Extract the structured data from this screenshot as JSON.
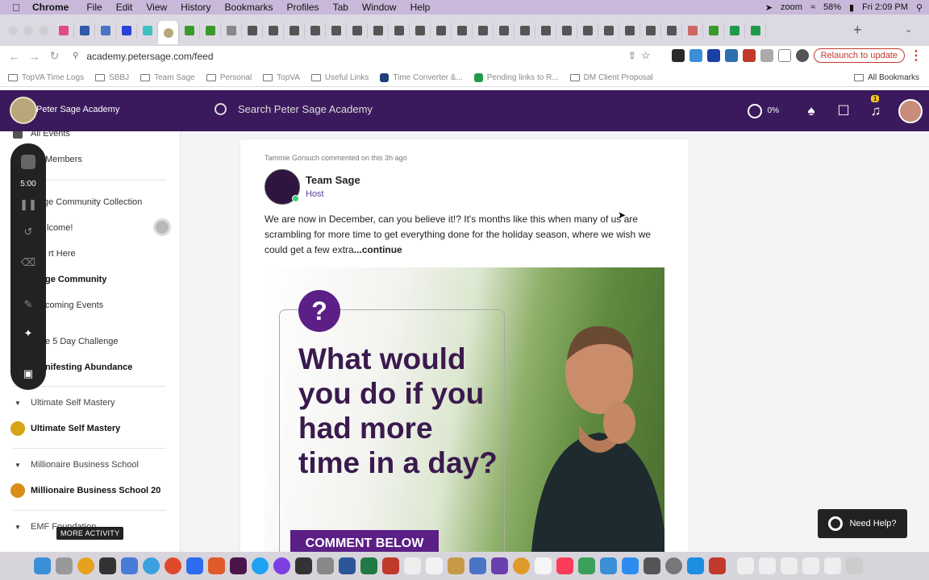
{
  "menubar": {
    "app": "Chrome",
    "items": [
      "File",
      "Edit",
      "View",
      "History",
      "Bookmarks",
      "Profiles",
      "Tab",
      "Window",
      "Help"
    ],
    "zoom_label": "zoom",
    "battery": "58%",
    "datetime": "Fri 2:09 PM"
  },
  "browser": {
    "url": "academy.petersage.com/feed",
    "relaunch_label": "Relaunch to update",
    "bookmarks": [
      "TopVA Time Logs",
      "SBBJ",
      "Team Sage",
      "Personal",
      "TopVA",
      "Useful Links",
      "Time Converter &...",
      "Pending links to R...",
      "DM Client Proposal"
    ],
    "all_bookmarks": "All Bookmarks"
  },
  "site": {
    "name": "Peter Sage Academy",
    "search_placeholder": "Search Peter Sage Academy",
    "progress": "0%",
    "notification_count": "1"
  },
  "sidebar": {
    "all_events": "All Events",
    "members": "Members",
    "community_collection": "ge Community Collection",
    "welcome": "lcome!",
    "start_here": "rt Here",
    "community": "ge Community",
    "upcoming": "coming Events",
    "challenge": "e 5 Day Challenge",
    "manifesting": "nifesting Abundance",
    "ultimate_section": "Ultimate Self Mastery",
    "ultimate_item": "Ultimate Self Mastery",
    "millionaire_section": "Millionaire Business School",
    "millionaire_item": "Millionaire Business School 20",
    "emf_section": "EMF Foundation",
    "more_activity": "MORE ACTIVITY",
    "rec_time": "5:00"
  },
  "post": {
    "meta": "Tammie Gorsuch commented on this 3h ago",
    "author": "Team Sage",
    "role": "Host",
    "body": "We are now in December, can you believe it!? It's months like this when many of us are scrambling for more time to get everything done for the holiday season, where we wish we could get a few extra",
    "continue": "...continue",
    "image_question": "?",
    "image_headline": "What would you do if you had more time in a day?",
    "image_cta": "COMMENT BELOW"
  },
  "help": {
    "label": "Need Help?"
  },
  "colors": {
    "header": "#3a1a5c",
    "accent": "#5b1f86",
    "menubar": "#c9b8d9"
  }
}
